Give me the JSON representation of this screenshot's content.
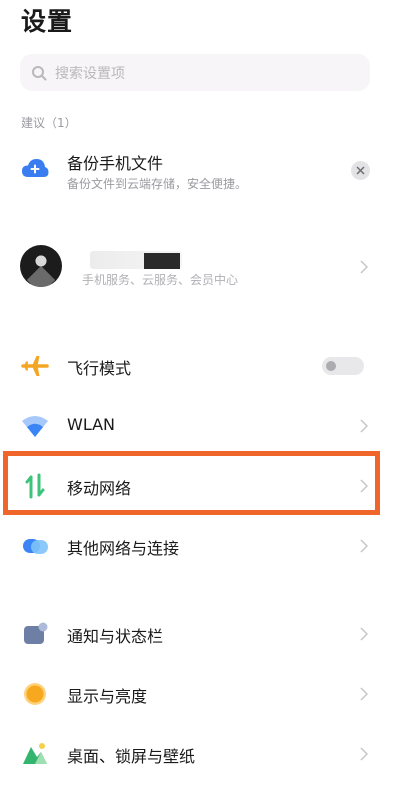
{
  "header": {
    "title": "设置"
  },
  "search": {
    "placeholder": "搜索设置项"
  },
  "suggestions": {
    "section_label": "建议（1）",
    "card": {
      "title": "备份手机文件",
      "subtitle": "备份文件到云端存储，安全便捷。",
      "icon": "cloud-icon"
    }
  },
  "account": {
    "subtitle": "手机服务、云服务、会员中心"
  },
  "rows": [
    {
      "label": "飞行模式",
      "icon": "airplane-icon",
      "toggle_on": false
    },
    {
      "label": "WLAN",
      "icon": "wifi-icon"
    },
    {
      "label": "移动网络",
      "icon": "mobile-data-icon",
      "highlighted": true
    },
    {
      "label": "其他网络与连接",
      "icon": "link-icon"
    },
    {
      "label": "通知与状态栏",
      "icon": "notification-icon"
    },
    {
      "label": "显示与亮度",
      "icon": "brightness-icon"
    },
    {
      "label": "桌面、锁屏与壁纸",
      "icon": "wallpaper-icon"
    }
  ],
  "colors": {
    "highlight": "#f0662a",
    "airplane": "#f5a524",
    "wifi": "#3a84f5",
    "mobile_data": "#3cc47a",
    "cloud": "#3a7df0"
  }
}
